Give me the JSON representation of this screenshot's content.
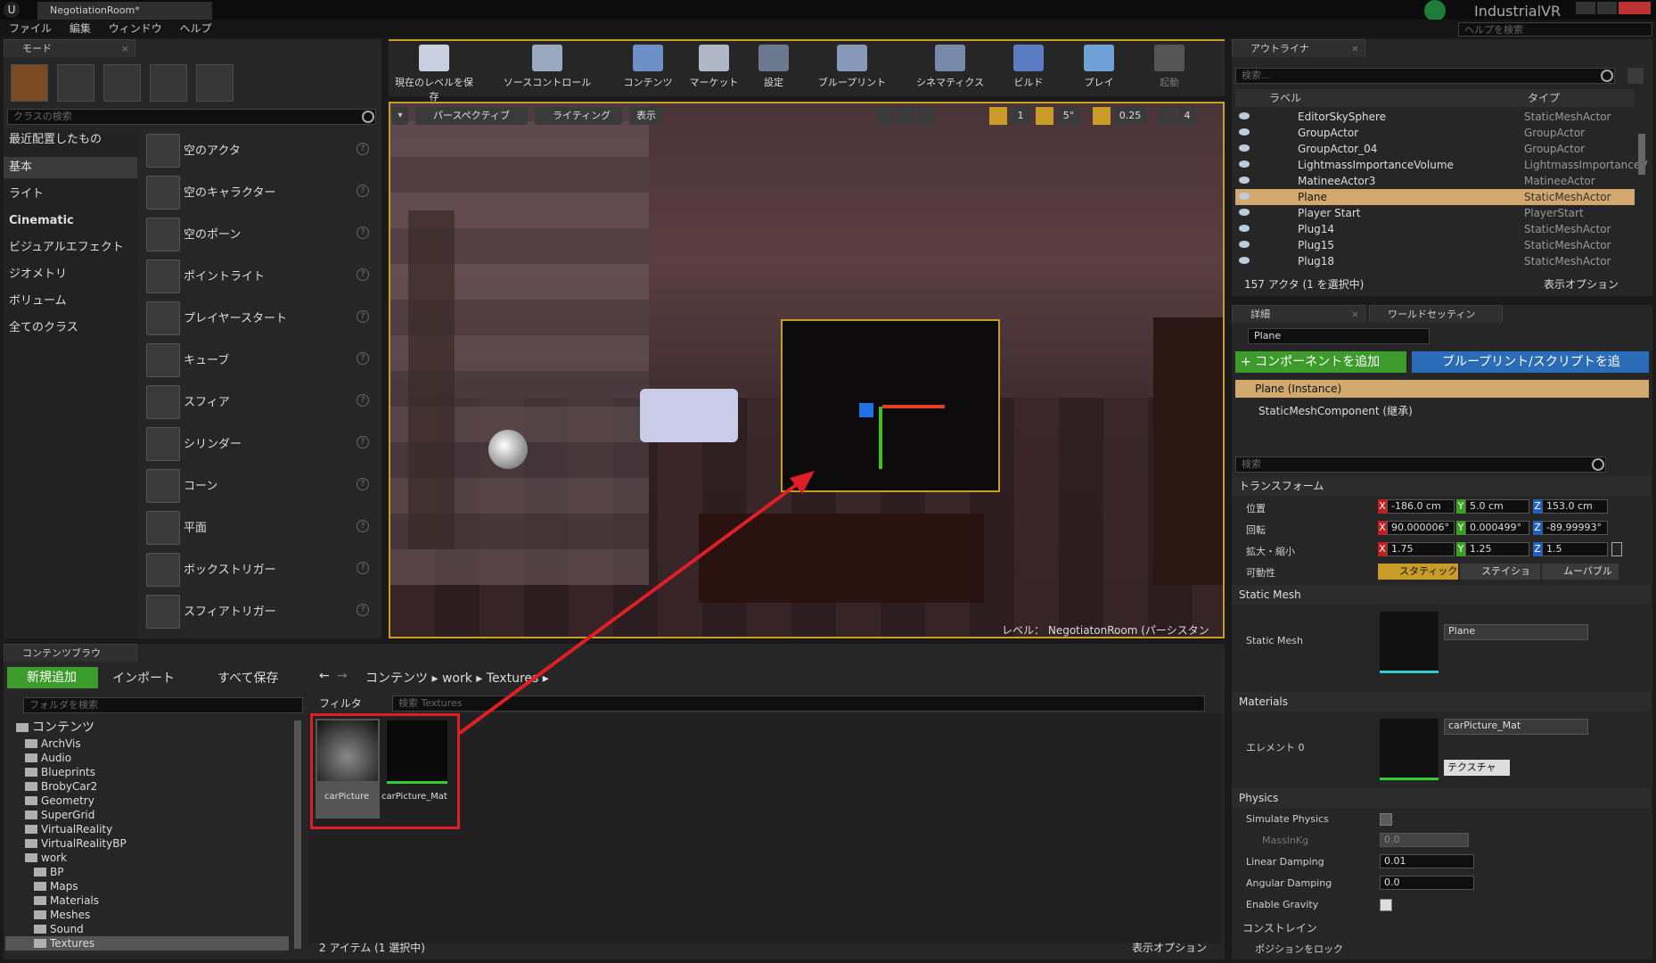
{
  "window": {
    "tab_title": "NegotiationRoom*",
    "project": "IndustrialVR",
    "help_search_placeholder": "ヘルプを検索"
  },
  "menu": [
    "ファイル",
    "編集",
    "ウィンドウ",
    "ヘルプ"
  ],
  "modes": {
    "tab_label": "モード",
    "search_placeholder": "クラスの検索",
    "categories": [
      "最近配置したもの",
      "基本",
      "ライト",
      "Cinematic",
      "ビジュアルエフェクト",
      "ジオメトリ",
      "ボリューム",
      "全てのクラス"
    ],
    "place_items": [
      "空のアクタ",
      "空のキャラクター",
      "空のポーン",
      "ポイントライト",
      "プレイヤースタート",
      "キューブ",
      "スフィア",
      "シリンダー",
      "コーン",
      "平面",
      "ボックストリガー",
      "スフィアトリガー"
    ]
  },
  "toolbar": {
    "buttons": [
      "現在のレベルを保存",
      "ソースコントロール",
      "コンテンツ",
      "マーケット",
      "設定",
      "ブループリント",
      "シネマティクス",
      "ビルド",
      "プレイ",
      "起動"
    ]
  },
  "viewport": {
    "perspective": "パースペクティブ",
    "lighting": "ライティング",
    "show": "表示",
    "grid_size": "1",
    "rotation_snap": "5°",
    "scale_snap": "0.25",
    "camera_speed": "4",
    "level_label": "レベル：",
    "level_name": "NegotiatonRoom (パーシスタント)"
  },
  "outliner": {
    "tab_label": "アウトライナ",
    "search_placeholder": "検索...",
    "col_label": "ラベル",
    "col_type": "タイプ",
    "rows": [
      {
        "name": "EditorSkySphere",
        "type": "StaticMeshActor"
      },
      {
        "name": "GroupActor",
        "type": "GroupActor"
      },
      {
        "name": "GroupActor_04",
        "type": "GroupActor"
      },
      {
        "name": "LightmassImportanceVolume",
        "type": "LightmassImportanceV"
      },
      {
        "name": "MatineeActor3",
        "type": "MatineeActor"
      },
      {
        "name": "Plane",
        "type": "StaticMeshActor"
      },
      {
        "name": "Player Start",
        "type": "PlayerStart"
      },
      {
        "name": "Plug14",
        "type": "StaticMeshActor"
      },
      {
        "name": "Plug15",
        "type": "StaticMeshActor"
      },
      {
        "name": "Plug18",
        "type": "StaticMeshActor"
      }
    ],
    "count": "157 アクタ (1 を選択中)",
    "view_options": "表示オプション"
  },
  "details": {
    "tab_label": "詳細",
    "tab2_label": "ワールドセッティン",
    "name_value": "Plane",
    "add_component": "+ コンポーネントを追加",
    "blueprint_script": "ブループリント/スクリプトを追",
    "instance": "Plane (Instance)",
    "component": "StaticMeshComponent (継承)",
    "search_placeholder": "検索",
    "transform_header": "トランスフォーム",
    "location_label": "位置",
    "rotation_label": "回転",
    "scale_label": "拡大・縮小",
    "mobility_label": "可動性",
    "location": [
      "-186.0 cm",
      "5.0 cm",
      "153.0 cm"
    ],
    "rotation": [
      "90.000006°",
      "0.000499°",
      "-89.99993°"
    ],
    "scale": [
      "1.75",
      "1.25",
      "1.5"
    ],
    "mobility": [
      "スタティック",
      "ステイショ",
      "ムーバブル"
    ],
    "static_mesh_header": "Static Mesh",
    "static_mesh_label": "Static Mesh",
    "static_mesh_value": "Plane",
    "materials_header": "Materials",
    "element_label": "エレメント 0",
    "material_value": "carPicture_Mat",
    "texture_btn": "テクスチャ",
    "physics_header": "Physics",
    "simulate_physics": "Simulate Physics",
    "mass": "MassInKg",
    "mass_value": "0.0",
    "linear_damping": "Linear Damping",
    "linear_damping_value": "0.01",
    "angular_damping": "Angular Damping",
    "angular_damping_value": "0.0",
    "enable_gravity": "Enable Gravity",
    "constraints_header": "コンストレイン",
    "lock_position": "ポジションをロック"
  },
  "content_browser": {
    "tab_label": "コンテンツブラウ",
    "add_new": "新規追加",
    "import": "インポート",
    "save_all": "すべて保存",
    "path": [
      "コンテンツ",
      "work",
      "Textures"
    ],
    "folder_search_placeholder": "フォルダを検索",
    "filter": "フィルタ",
    "asset_search_placeholder": "検索 Textures",
    "tree_root": "コンテンツ",
    "tree": [
      "ArchVis",
      "Audio",
      "Blueprints",
      "BrobyCar2",
      "Geometry",
      "SuperGrid",
      "VirtualReality",
      "VirtualRealityBP",
      "work"
    ],
    "work_children": [
      "BP",
      "Maps",
      "Materials",
      "Meshes",
      "Sound",
      "Textures"
    ],
    "assets": [
      "carPicture",
      "carPicture_Mat"
    ],
    "item_count": "2 アイテム (1 選択中)",
    "view_options": "表示オプション"
  },
  "colors": {
    "accent_green": "#3c9b2a",
    "selection": "#d2a86e",
    "annotation_red": "#e01e25",
    "toolbar_yellow": "#c99c2a"
  }
}
